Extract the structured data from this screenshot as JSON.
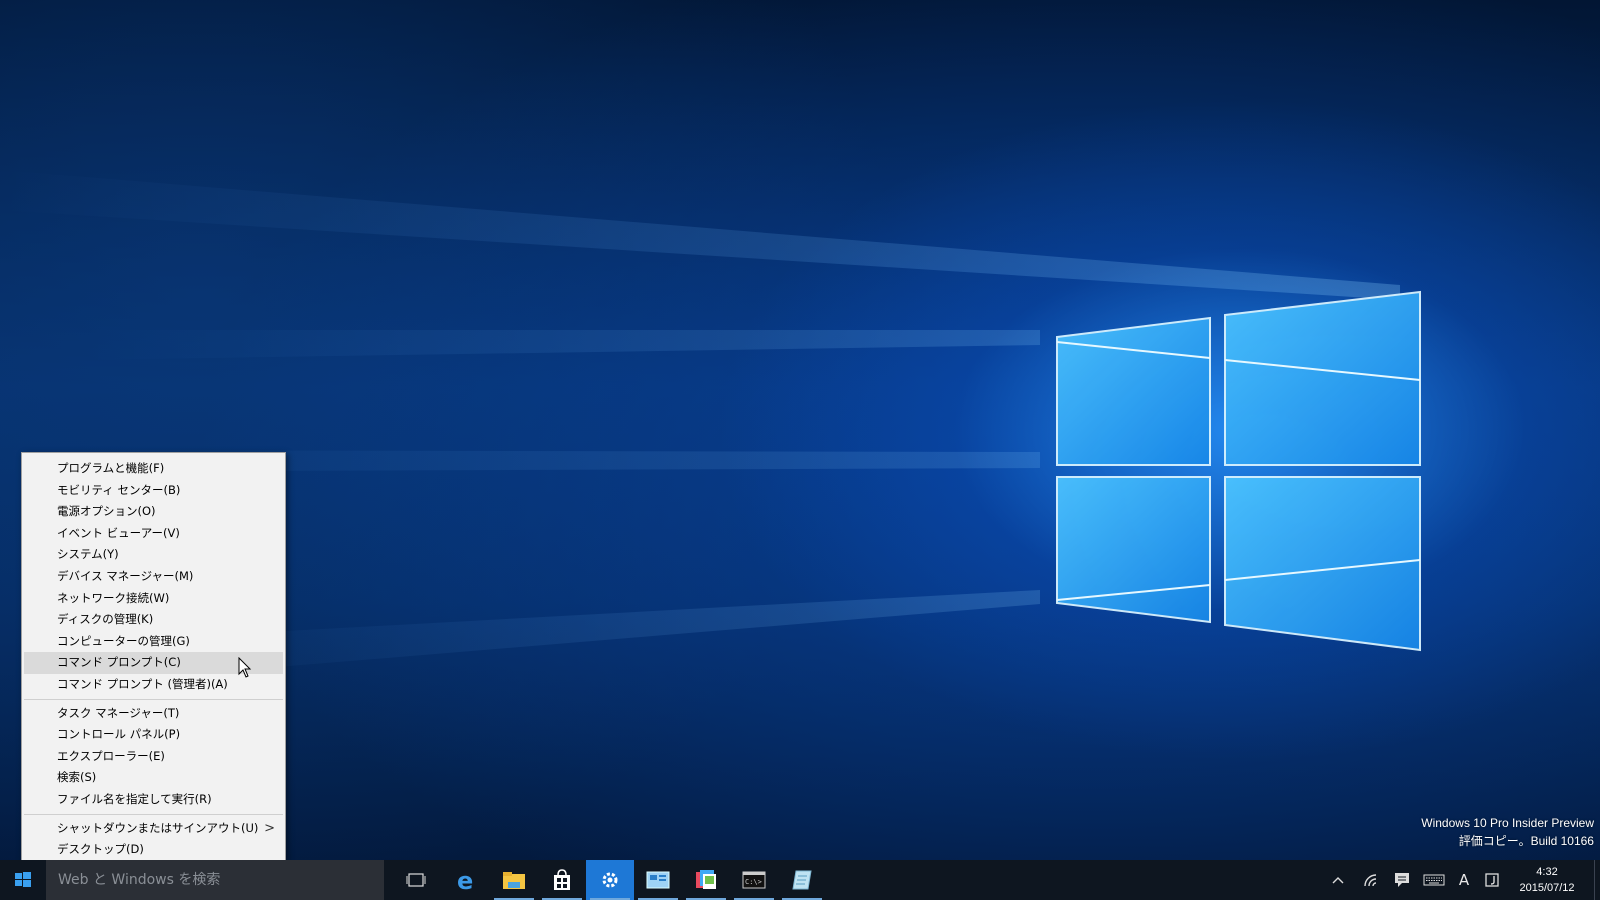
{
  "desktop": {
    "watermark_line1": "Windows 10 Pro Insider Preview",
    "watermark_line2": "評価コピー。Build 10166"
  },
  "winx_menu": {
    "group1": [
      "プログラムと機能(F)",
      "モビリティ センター(B)",
      "電源オプション(O)",
      "イベント ビューアー(V)",
      "システム(Y)",
      "デバイス マネージャー(M)",
      "ネットワーク接続(W)",
      "ディスクの管理(K)",
      "コンピューターの管理(G)",
      "コマンド プロンプト(C)",
      "コマンド プロンプト (管理者)(A)"
    ],
    "group2": [
      "タスク マネージャー(T)",
      "コントロール パネル(P)",
      "エクスプローラー(E)",
      "検索(S)",
      "ファイル名を指定して実行(R)"
    ],
    "group3": [
      "シャットダウンまたはサインアウト(U)",
      "デスクトップ(D)"
    ],
    "submenu_arrow": ">",
    "hovered_item": "コマンド プロンプト(C)"
  },
  "taskbar": {
    "search_placeholder": "Web と Windows を検索",
    "pinned_apps": [
      "task-view",
      "edge",
      "file-explorer",
      "store",
      "settings",
      "control-panel",
      "photos",
      "command-prompt",
      "notepad"
    ],
    "tray": {
      "ime_label": "A",
      "clock_time": "4:32",
      "clock_date": "2015/07/12"
    }
  },
  "colors": {
    "accent": "#1e90ff",
    "taskbar_bg": "#0e1620",
    "menu_bg": "#f2f2f2",
    "hover_bg": "#dadada"
  }
}
